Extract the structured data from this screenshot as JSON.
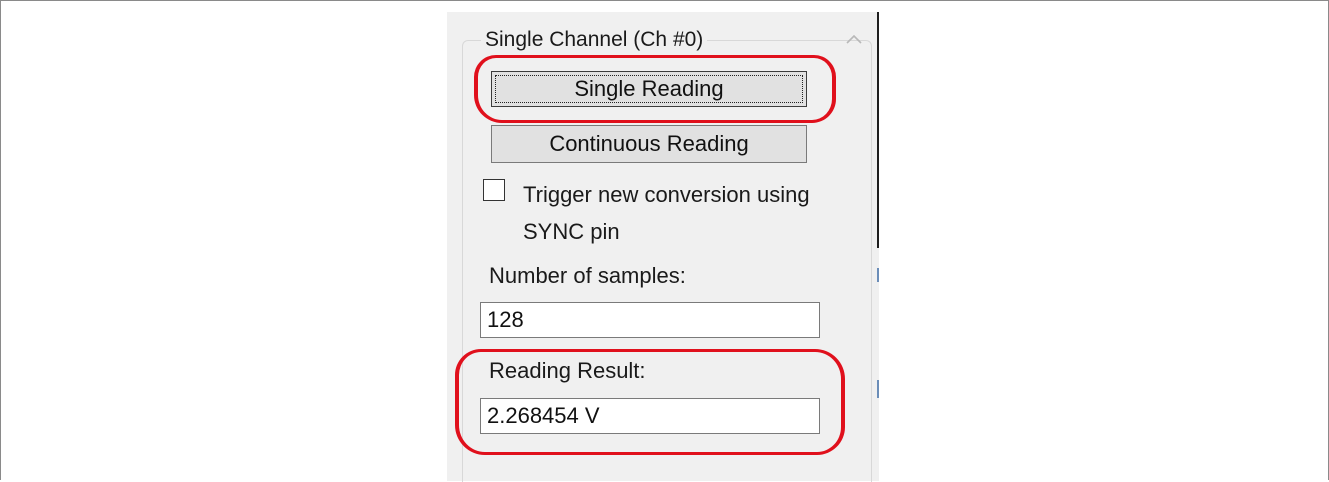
{
  "group": {
    "title": "Single Channel (Ch #0)"
  },
  "buttons": {
    "single_reading": "Single Reading",
    "continuous_reading": "Continuous Reading"
  },
  "trigger": {
    "label": "Trigger new conversion using SYNC pin",
    "checked": false
  },
  "samples": {
    "label": "Number of samples:",
    "value": "128"
  },
  "result": {
    "label": "Reading Result:",
    "value": "2.268454 V"
  },
  "icons": {
    "scroll_up": "chevron-up-icon",
    "checkbox": "checkbox-icon"
  },
  "colors": {
    "annotation": "#e0101c",
    "panel_bg": "#f0f0f0"
  }
}
